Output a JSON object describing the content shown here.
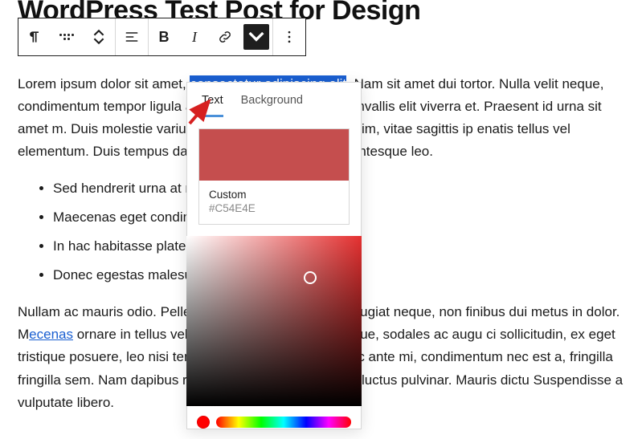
{
  "heading": "WordPress Test Post for Design",
  "toolbar": {
    "bold": "B",
    "italic": "I"
  },
  "paragraph1": {
    "pre": "Lorem ipsum dolor sit amet, ",
    "highlight": "consectetur adipiscing elit",
    "post": ". Nam sit amet dui tortor. Nulla velit neque, condimentum tempor ligula a,",
    "line2_a": "porta massa purus, vel convallis elit viverra et. Praesent id urna sit amet",
    "line2_b": "m. Duis molestie varius erat. Nullam sed sagittis enim, vitae sagittis ip",
    "line2_c": "enatis tellus vel elementum. Duis tempus dapibus augue ac volutpat. A",
    "line2_d": "entesque leo."
  },
  "bullets": [
    "Sed hendrerit urna at m",
    "Maecenas eget condim",
    "In hac habitasse platea",
    "Donec egestas malesu                                                      mper aliquet."
  ],
  "paragraph2": {
    "a": "Nullam ac mauris odio. Pelle",
    "b": "nia tempor, libero magna feugiat neque, non finibus dui metus in dolor. M",
    "link": "ecenas",
    "c": " ornare in tellus vel fermentum. Duis augue neque, sodales ac augu",
    "d": "ci sollicitudin, ex eget tristique posuere, leo nisi tempor lorem, ac rutru",
    "e": "s. Donec ante mi, condimentum nec est a, fringilla fringilla sem. Nam",
    "f": "dapibus risus ac molestie. Ut rhoncus luctus pulvinar. Mauris dictu",
    "g": " Suspendisse a vulputate libero."
  },
  "popover": {
    "tab_text": "Text",
    "tab_background": "Background",
    "custom_label": "Custom",
    "hex": "#C54E4E"
  }
}
